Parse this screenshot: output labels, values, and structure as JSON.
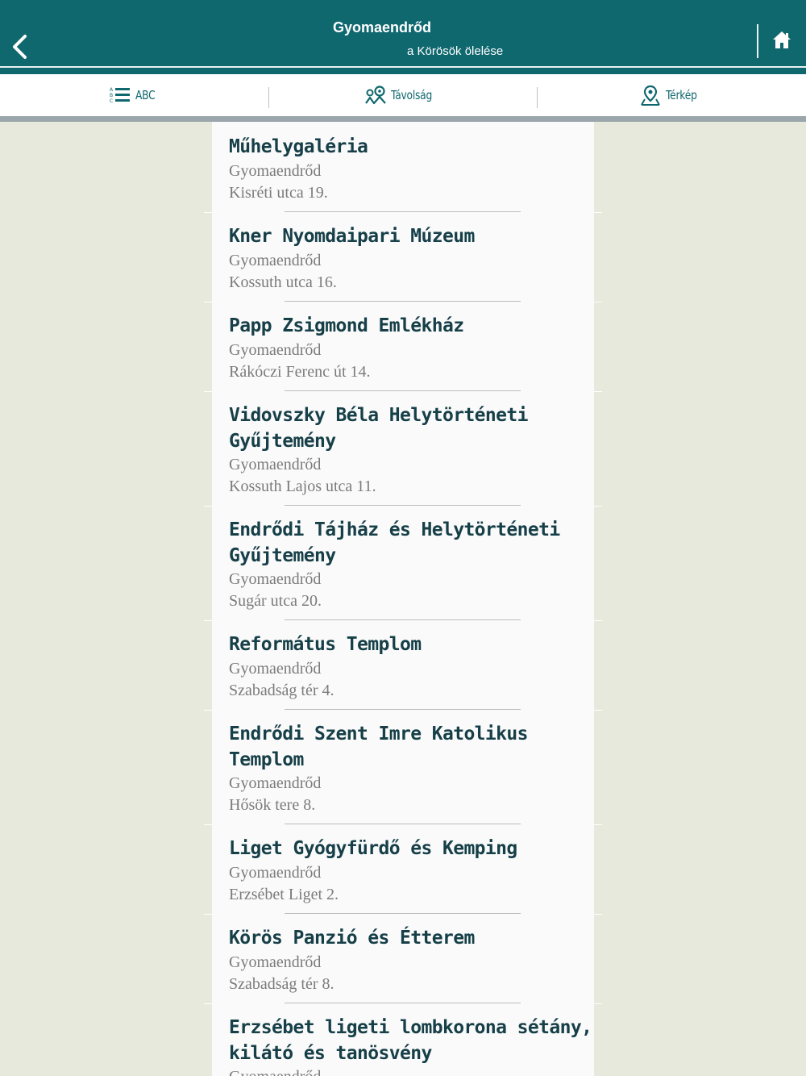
{
  "header": {
    "title": "Gyomaendrőd",
    "subtitle": "a Körösök ölelése",
    "back_icon": "chevron-left-icon",
    "home_icon": "home-icon",
    "background": "#10686f"
  },
  "tabs": [
    {
      "label": "ABC",
      "icon": "list-icon"
    },
    {
      "label": "Távolság",
      "icon": "map-route-icon"
    },
    {
      "label": "Térkép",
      "icon": "map-pin-icon"
    }
  ],
  "places": [
    {
      "name": [
        "Műhelygaléria"
      ],
      "city": "Gyomaendrőd",
      "address": "Kisréti utca 19."
    },
    {
      "name": [
        "Kner Nyomdaipari Múzeum"
      ],
      "city": "Gyomaendrőd",
      "address": "Kossuth utca 16."
    },
    {
      "name": [
        "Papp Zsigmond Emlékház"
      ],
      "city": "Gyomaendrőd",
      "address": "Rákóczi Ferenc út 14."
    },
    {
      "name": [
        "Vidovszky Béla Helytörténeti",
        "Gyűjtemény"
      ],
      "city": "Gyomaendrőd",
      "address": "Kossuth Lajos utca 11."
    },
    {
      "name": [
        "Endrődi Tájház és Helytörténeti",
        "Gyűjtemény"
      ],
      "city": "Gyomaendrőd",
      "address": "Sugár utca 20."
    },
    {
      "name": [
        "Református Templom"
      ],
      "city": "Gyomaendrőd",
      "address": "Szabadság tér 4."
    },
    {
      "name": [
        "Endrődi Szent Imre Katolikus",
        "Templom"
      ],
      "city": "Gyomaendrőd",
      "address": "Hősök tere 8."
    },
    {
      "name": [
        "Liget Gyógyfürdő és Kemping"
      ],
      "city": "Gyomaendrőd",
      "address": "Erzsébet Liget 2."
    },
    {
      "name": [
        "Körös Panzió és Étterem"
      ],
      "city": "Gyomaendrőd",
      "address": "Szabadság tér 8."
    },
    {
      "name": [
        "Erzsébet ligeti lombkorona sétány,",
        "kilátó és tanösvény"
      ],
      "city": "Gyomaendrőd",
      "address": ""
    }
  ]
}
